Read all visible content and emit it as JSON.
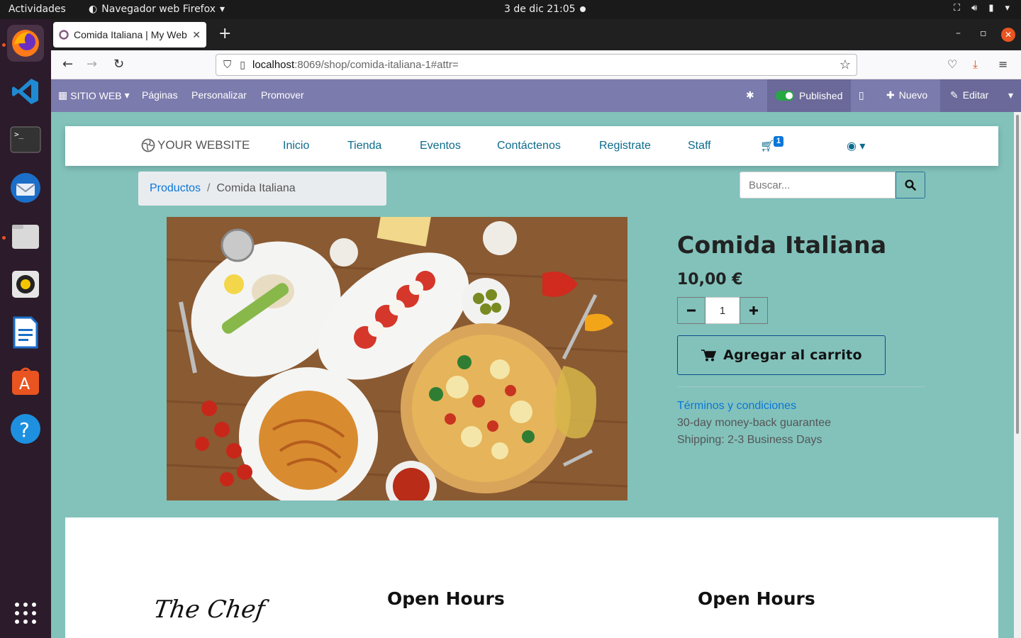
{
  "os": {
    "activities": "Actividades",
    "app_name": "Navegador web Firefox",
    "clock": "3 de dic  21:05"
  },
  "browser": {
    "tab_title": "Comida Italiana | My Web",
    "url_host": "localhost",
    "url_path": ":8069/shop/comida-italiana-1#attr="
  },
  "odoo_bar": {
    "site_menu": "SITIO WEB",
    "pages": "Páginas",
    "customize": "Personalizar",
    "promote": "Promover",
    "published": "Published",
    "new": "Nuevo",
    "edit": "Editar"
  },
  "site": {
    "logo": "YOUR WEBSITE",
    "menu": [
      "Inicio",
      "Tienda",
      "Eventos",
      "Contáctenos",
      "Registrate",
      "Staff"
    ],
    "cart_count": "1"
  },
  "breadcrumb": {
    "parent": "Productos",
    "sep": "/",
    "current": "Comida Italiana"
  },
  "search": {
    "placeholder": "Buscar..."
  },
  "product": {
    "name": "Comida Italiana",
    "price": "10,00 €",
    "quantity": "1",
    "add_to_cart": "Agregar al carrito",
    "terms": "Términos y condiciones",
    "guarantee": "30-day money-back guarantee",
    "shipping": "Shipping: 2-3 Business Days"
  },
  "footer": {
    "chef": "The Chef",
    "hours_1": "Open Hours",
    "hours_2": "Open Hours"
  },
  "colors": {
    "page_bg": "#82c2bb",
    "odoo_bar": "#7c7bad",
    "link": "#0b76d9",
    "accent_orange": "#e95420"
  }
}
